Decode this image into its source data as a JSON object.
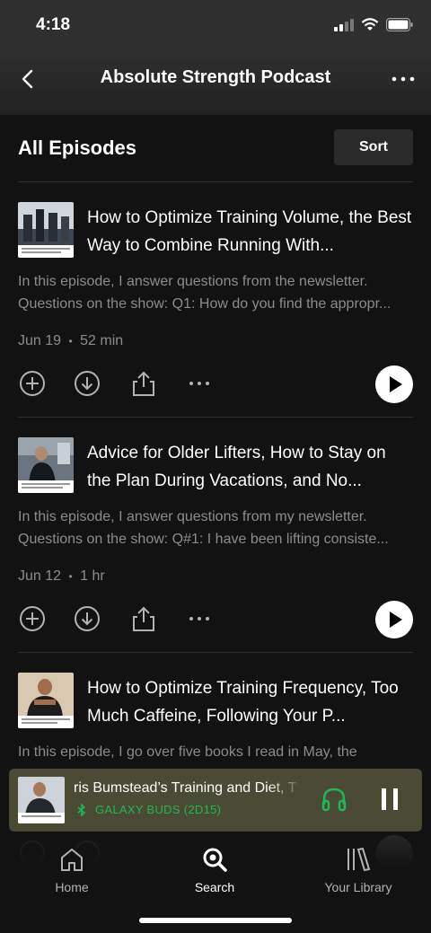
{
  "status": {
    "time": "4:18"
  },
  "header": {
    "title": "Absolute Strength Podcast"
  },
  "section": {
    "title": "All Episodes",
    "sort_label": "Sort"
  },
  "episodes": [
    {
      "title": "How to Optimize Training Volume, the Best Way to Combine Running With...",
      "description": "In this episode, I answer questions from the newsletter. Questions on the show: Q1: How do you find the appropr...",
      "date": "Jun 19",
      "duration": "52 min"
    },
    {
      "title": "Advice for Older Lifters, How to Stay on the Plan During Vacations, and No...",
      "description": "In this episode, I answer questions from my newsletter. Questions on the show: Q#1:  I have been lifting consiste...",
      "date": "Jun 12",
      "duration": "1 hr"
    },
    {
      "title": "How to Optimize Training Frequency, Too Much Caffeine, Following Your P...",
      "description": "In this episode, I go over five books I read in May, the"
    }
  ],
  "meta_separator": "•",
  "now_playing": {
    "title": "ris Bumstead’s Training and Diet, T",
    "device": "GALAXY BUDS (2D15)"
  },
  "tabs": [
    {
      "label": "Home",
      "icon": "home-icon"
    },
    {
      "label": "Search",
      "icon": "search-icon"
    },
    {
      "label": "Your Library",
      "icon": "library-icon"
    }
  ],
  "colors": {
    "accent": "#1db954",
    "background": "#121212",
    "mini_player": "#4b4a34"
  }
}
